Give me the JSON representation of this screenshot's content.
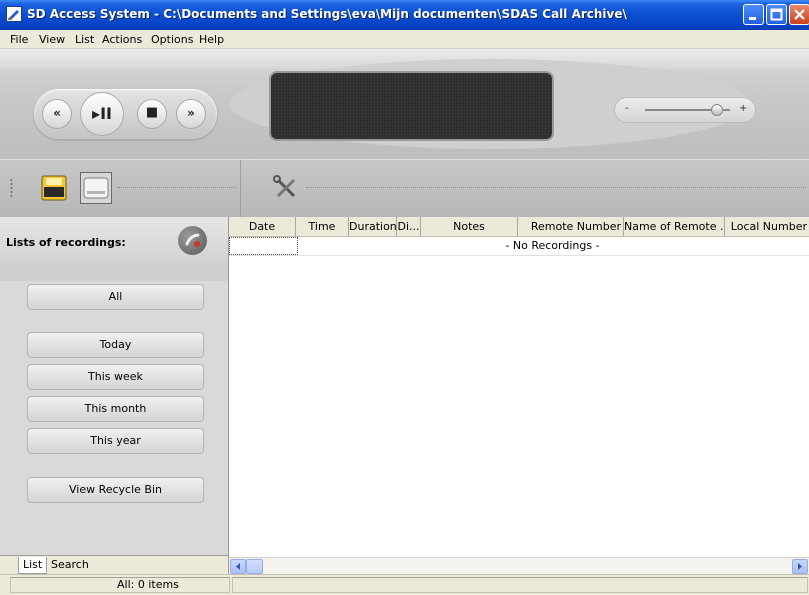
{
  "window": {
    "title": "SD Access System - C:\\Documents and Settings\\eva\\Mijn documenten\\SDAS Call Archive\\",
    "controls": [
      "minimize-icon",
      "maximize-icon",
      "close-icon"
    ]
  },
  "menu": {
    "items": [
      "File",
      "View",
      "List",
      "Actions",
      "Options",
      "Help"
    ]
  },
  "player": {
    "transport": [
      "previous-icon",
      "play-pause-icon",
      "stop-icon",
      "next-icon"
    ],
    "volume": {
      "min_label": "-",
      "max_label": "+",
      "level": 0.82
    }
  },
  "toolbar": {
    "icons": [
      "memory-card-icon",
      "drive-icon",
      "tools-icon"
    ]
  },
  "left_panel": {
    "title": "Lists of recordings:",
    "icon": "recording-phone-icon",
    "buttons": [
      "All",
      "Today",
      "This week",
      "This month",
      "This year",
      "View Recycle Bin"
    ],
    "tabs": [
      "List",
      "Search"
    ],
    "active_tab": "List"
  },
  "table": {
    "columns": [
      "Date",
      "Time",
      "Duration",
      "Di...",
      "Notes",
      "Remote Number",
      "Name of Remote ...",
      "Local Number"
    ],
    "empty_message": "- No Recordings -"
  },
  "status": {
    "text": "All: 0 items"
  },
  "colors": {
    "titlebar": "#0a4fd0",
    "close_button": "#c9401c",
    "panel_bg": "#d9d9d9"
  }
}
